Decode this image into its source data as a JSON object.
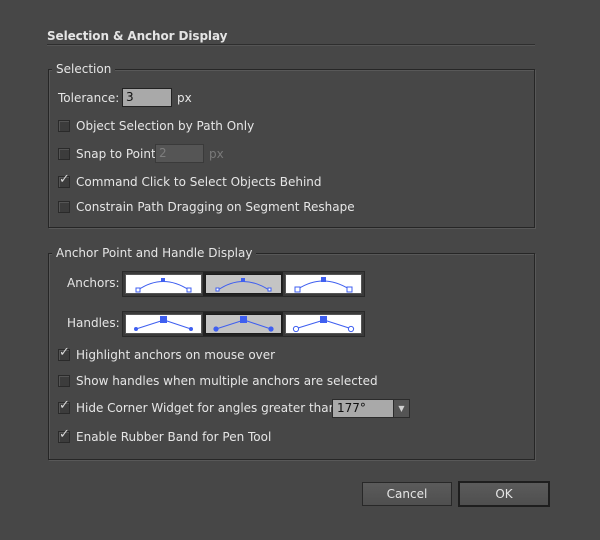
{
  "panel": {
    "title": "Selection & Anchor Display"
  },
  "selection_group": {
    "legend": "Selection",
    "tolerance": {
      "label": "Tolerance:",
      "value": "3",
      "unit": "px"
    },
    "object_selection_by_path": {
      "label": "Object Selection by Path Only",
      "checked": false
    },
    "snap_to_point": {
      "label": "Snap to Point",
      "checked": false,
      "value": "2",
      "unit": "px",
      "enabled": false
    },
    "command_click": {
      "label": "Command Click to Select Objects Behind",
      "checked": true
    },
    "constrain_path": {
      "label": "Constrain Path Dragging on Segment Reshape",
      "checked": false
    }
  },
  "anchor_group": {
    "legend": "Anchor Point and Handle Display",
    "anchors": {
      "label": "Anchors:",
      "options": [
        "small-hollow-anchors",
        "small-hollow-anchors-alt",
        "large-hollow-anchors"
      ],
      "selected_index": 1
    },
    "handles": {
      "label": "Handles:",
      "options": [
        "small-solid-handles",
        "large-solid-handles",
        "hollow-handles"
      ],
      "selected_index": 1
    },
    "highlight_anchors": {
      "label": "Highlight anchors on mouse over",
      "checked": true
    },
    "show_handles_multiple": {
      "label": "Show handles when multiple anchors are selected",
      "checked": false
    },
    "hide_corner_widget": {
      "label": "Hide Corner Widget for angles greater than:",
      "checked": true,
      "value": "177°"
    },
    "rubber_band": {
      "label": "Enable Rubber Band for Pen Tool",
      "checked": true
    }
  },
  "buttons": {
    "cancel": "Cancel",
    "ok": "OK"
  },
  "colors": {
    "background": "#474747",
    "accent_blue": "#3f5ff0",
    "check_mark": "✓",
    "dropdown_arrow": "▼"
  }
}
